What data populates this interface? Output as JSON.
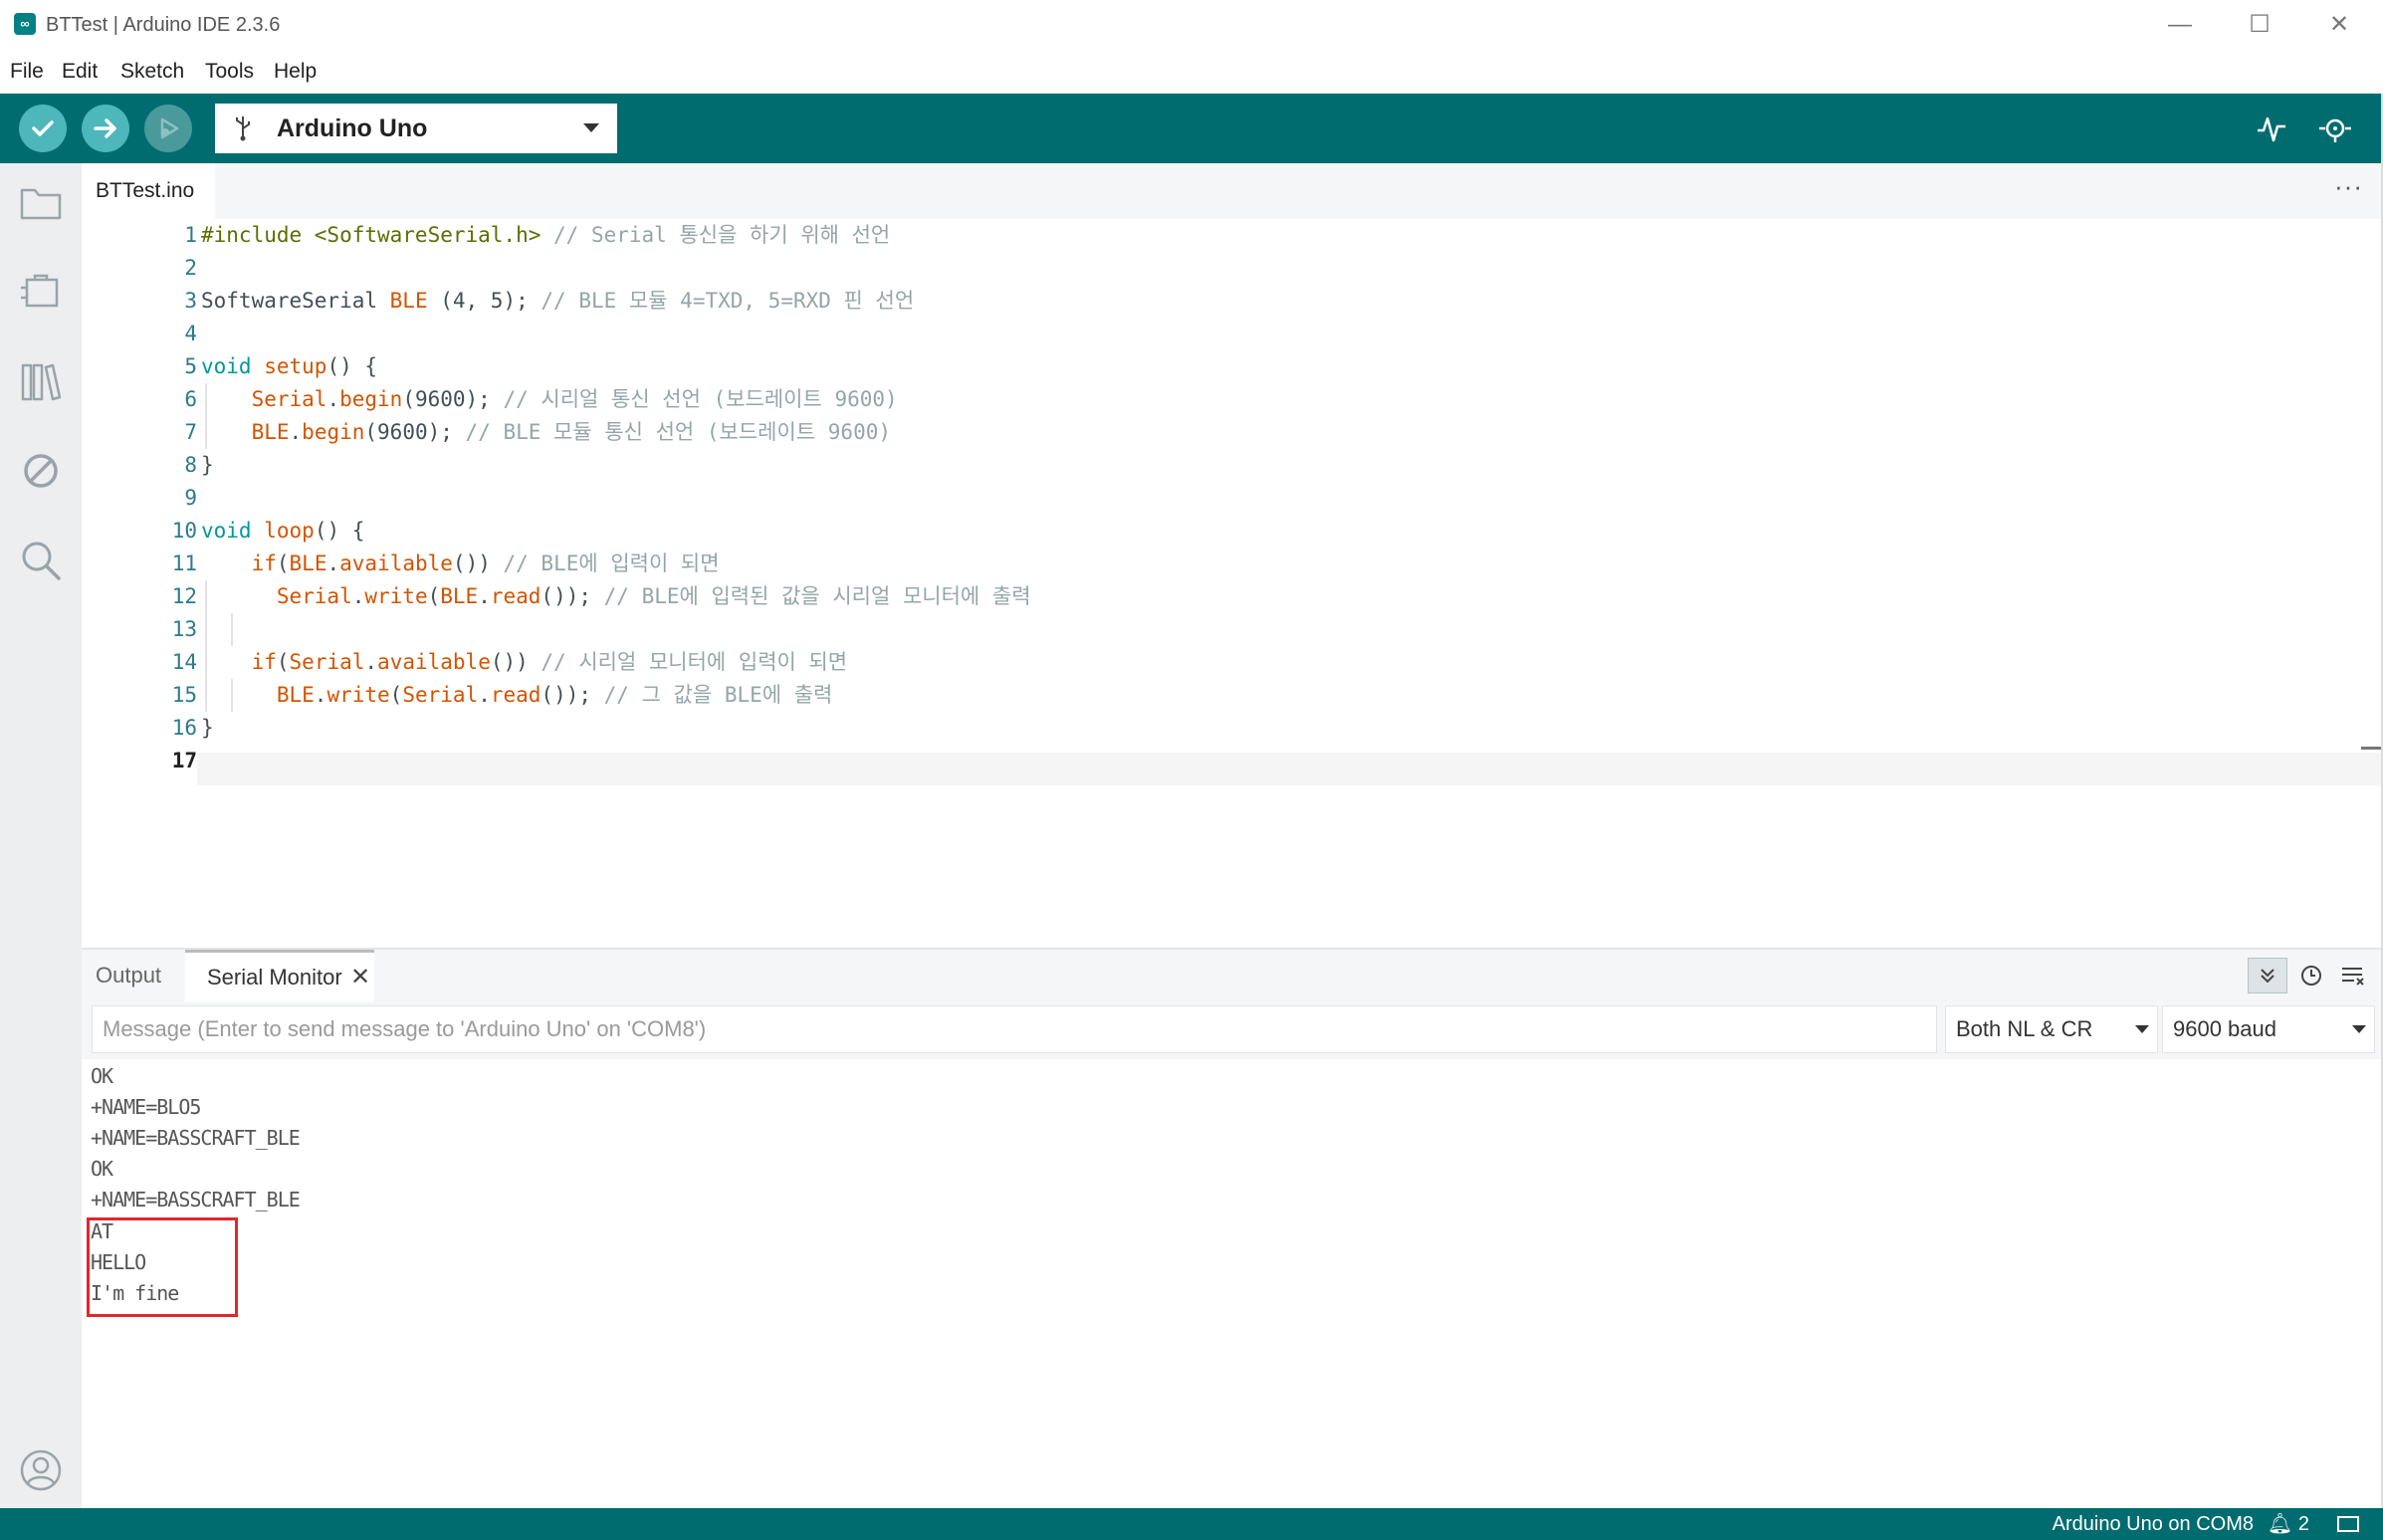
{
  "window": {
    "title": "BTTest | Arduino IDE 2.3.6",
    "app_icon": "∞",
    "controls": {
      "minimize": "—",
      "maximize": "☐",
      "close": "✕"
    }
  },
  "menu": [
    "File",
    "Edit",
    "Sketch",
    "Tools",
    "Help"
  ],
  "toolbar": {
    "board": "Arduino Uno",
    "usb_icon": "⚲",
    "buttons": [
      "verify-icon",
      "upload-icon",
      "debug-icon",
      "serial-plotter-icon",
      "serial-monitor-icon"
    ]
  },
  "sidebar": {
    "icons": [
      "folder-icon",
      "boards-manager-icon",
      "library-icon",
      "debug-disabled-icon",
      "search-icon",
      "account-icon"
    ]
  },
  "editor": {
    "tab": "BTTest.ino",
    "more": "···",
    "line_numbers": [
      "1",
      "2",
      "3",
      "4",
      "5",
      "6",
      "7",
      "8",
      "9",
      "10",
      "11",
      "12",
      "13",
      "14",
      "15",
      "16",
      "17"
    ]
  },
  "panel": {
    "tab_output": "Output",
    "tab_serial": "Serial Monitor",
    "close": "✕",
    "message_placeholder": "Message (Enter to send message to 'Arduino Uno' on 'COM8')",
    "line_ending": "Both NL & CR",
    "baud": "9600 baud",
    "output_lines": [
      "OK",
      "+NAME=BLO5",
      "+NAME=BASSCRAFT_BLE",
      "OK",
      "+NAME=BASSCRAFT_BLE",
      "AT",
      "HELLO",
      "I'm fine"
    ]
  },
  "statusbar": {
    "board_port": "Arduino Uno on COM8",
    "notifications": "2"
  },
  "colors": {
    "accent": "#006c70",
    "toolbar_button": "#4db7bb",
    "highlight": "#e3262d"
  }
}
